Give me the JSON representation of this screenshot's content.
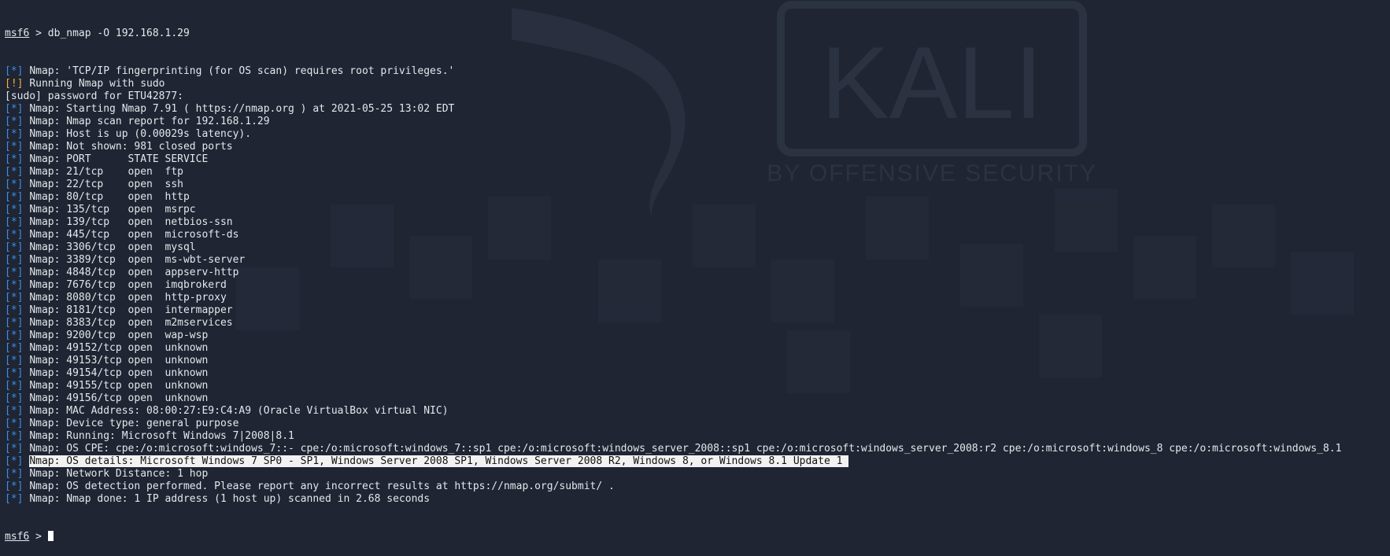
{
  "theme": {
    "background": "#1f2532",
    "text": "#e4e7ec",
    "info_tag": "#3b8eea",
    "warn_tag": "#f5b041",
    "highlight_bg": "#f2f2f2"
  },
  "watermark": {
    "logo_text": "KALI",
    "tagline": "BY OFFENSIVE SECURITY"
  },
  "prompt": {
    "name": "msf6",
    "symbol": ">"
  },
  "terminal": {
    "command": "db_nmap -O 192.168.1.29",
    "lines": [
      {
        "tag": "[*]",
        "text": "Nmap: 'TCP/IP fingerprinting (for OS scan) requires root privileges.'"
      },
      {
        "tag": "[!]",
        "text": "Running Nmap with sudo"
      },
      {
        "tag": "",
        "text": "[sudo] password for ETU42877:"
      },
      {
        "tag": "[*]",
        "text": "Nmap: Starting Nmap 7.91 ( https://nmap.org ) at 2021-05-25 13:02 EDT"
      },
      {
        "tag": "[*]",
        "text": "Nmap: Nmap scan report for 192.168.1.29"
      },
      {
        "tag": "[*]",
        "text": "Nmap: Host is up (0.00029s latency)."
      },
      {
        "tag": "[*]",
        "text": "Nmap: Not shown: 981 closed ports"
      },
      {
        "tag": "[*]",
        "text": "Nmap: PORT      STATE SERVICE"
      },
      {
        "tag": "[*]",
        "text": "Nmap: 21/tcp    open  ftp"
      },
      {
        "tag": "[*]",
        "text": "Nmap: 22/tcp    open  ssh"
      },
      {
        "tag": "[*]",
        "text": "Nmap: 80/tcp    open  http"
      },
      {
        "tag": "[*]",
        "text": "Nmap: 135/tcp   open  msrpc"
      },
      {
        "tag": "[*]",
        "text": "Nmap: 139/tcp   open  netbios-ssn"
      },
      {
        "tag": "[*]",
        "text": "Nmap: 445/tcp   open  microsoft-ds"
      },
      {
        "tag": "[*]",
        "text": "Nmap: 3306/tcp  open  mysql"
      },
      {
        "tag": "[*]",
        "text": "Nmap: 3389/tcp  open  ms-wbt-server"
      },
      {
        "tag": "[*]",
        "text": "Nmap: 4848/tcp  open  appserv-http"
      },
      {
        "tag": "[*]",
        "text": "Nmap: 7676/tcp  open  imqbrokerd"
      },
      {
        "tag": "[*]",
        "text": "Nmap: 8080/tcp  open  http-proxy"
      },
      {
        "tag": "[*]",
        "text": "Nmap: 8181/tcp  open  intermapper"
      },
      {
        "tag": "[*]",
        "text": "Nmap: 8383/tcp  open  m2mservices"
      },
      {
        "tag": "[*]",
        "text": "Nmap: 9200/tcp  open  wap-wsp"
      },
      {
        "tag": "[*]",
        "text": "Nmap: 49152/tcp open  unknown"
      },
      {
        "tag": "[*]",
        "text": "Nmap: 49153/tcp open  unknown"
      },
      {
        "tag": "[*]",
        "text": "Nmap: 49154/tcp open  unknown"
      },
      {
        "tag": "[*]",
        "text": "Nmap: 49155/tcp open  unknown"
      },
      {
        "tag": "[*]",
        "text": "Nmap: 49156/tcp open  unknown"
      },
      {
        "tag": "[*]",
        "text": "Nmap: MAC Address: 08:00:27:E9:C4:A9 (Oracle VirtualBox virtual NIC)"
      },
      {
        "tag": "[*]",
        "text": "Nmap: Device type: general purpose"
      },
      {
        "tag": "[*]",
        "text": "Nmap: Running: Microsoft Windows 7|2008|8.1"
      },
      {
        "tag": "[*]",
        "text": "Nmap: OS CPE: cpe:/o:microsoft:windows_7::- cpe:/o:microsoft:windows_7::sp1 cpe:/o:microsoft:windows_server_2008::sp1 cpe:/o:microsoft:windows_server_2008:r2 cpe:/o:microsoft:windows_8 cpe:/o:microsoft:windows_8.1"
      },
      {
        "tag": "[*]",
        "text": "Nmap: OS details: Microsoft Windows 7 SP0 - SP1, Windows Server 2008 SP1, Windows Server 2008 R2, Windows 8, or Windows 8.1 Update 1 ",
        "highlight": true
      },
      {
        "tag": "[*]",
        "text": "Nmap: Network Distance: 1 hop"
      },
      {
        "tag": "[*]",
        "text": "Nmap: OS detection performed. Please report any incorrect results at https://nmap.org/submit/ ."
      },
      {
        "tag": "[*]",
        "text": "Nmap: Nmap done: 1 IP address (1 host up) scanned in 2.68 seconds"
      }
    ]
  }
}
